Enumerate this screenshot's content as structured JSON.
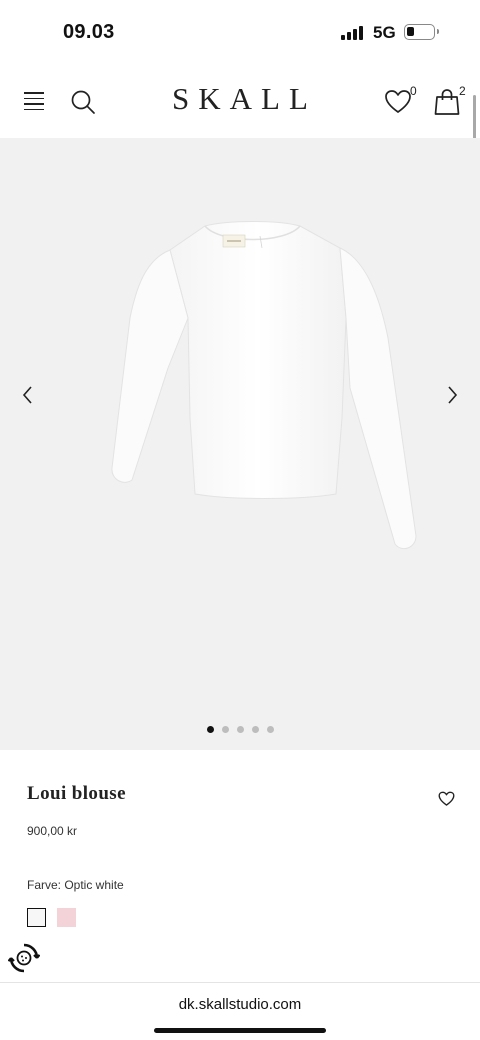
{
  "status_bar": {
    "time": "09.03",
    "network": "5G",
    "battery_level": 0.3
  },
  "header": {
    "logo": "SKALL",
    "wishlist_count": "0",
    "bag_count": "2"
  },
  "gallery": {
    "image_count": 5,
    "active_index": 0
  },
  "product": {
    "title": "Loui blouse",
    "price": "900,00 kr",
    "color_label": "Farve: Optic white",
    "swatches": [
      {
        "name": "Optic white",
        "color": "#f7f7f7",
        "selected": true
      },
      {
        "name": "Pink",
        "color": "#f3d3d8",
        "selected": false
      }
    ]
  },
  "browser": {
    "url": "dk.skallstudio.com"
  },
  "icons": {
    "menu": "menu-icon",
    "search": "search-icon",
    "wishlist": "heart-icon",
    "bag": "shopping-bag-icon",
    "prev": "chevron-left-icon",
    "next": "chevron-right-icon",
    "consent": "cookie-consent-icon"
  }
}
